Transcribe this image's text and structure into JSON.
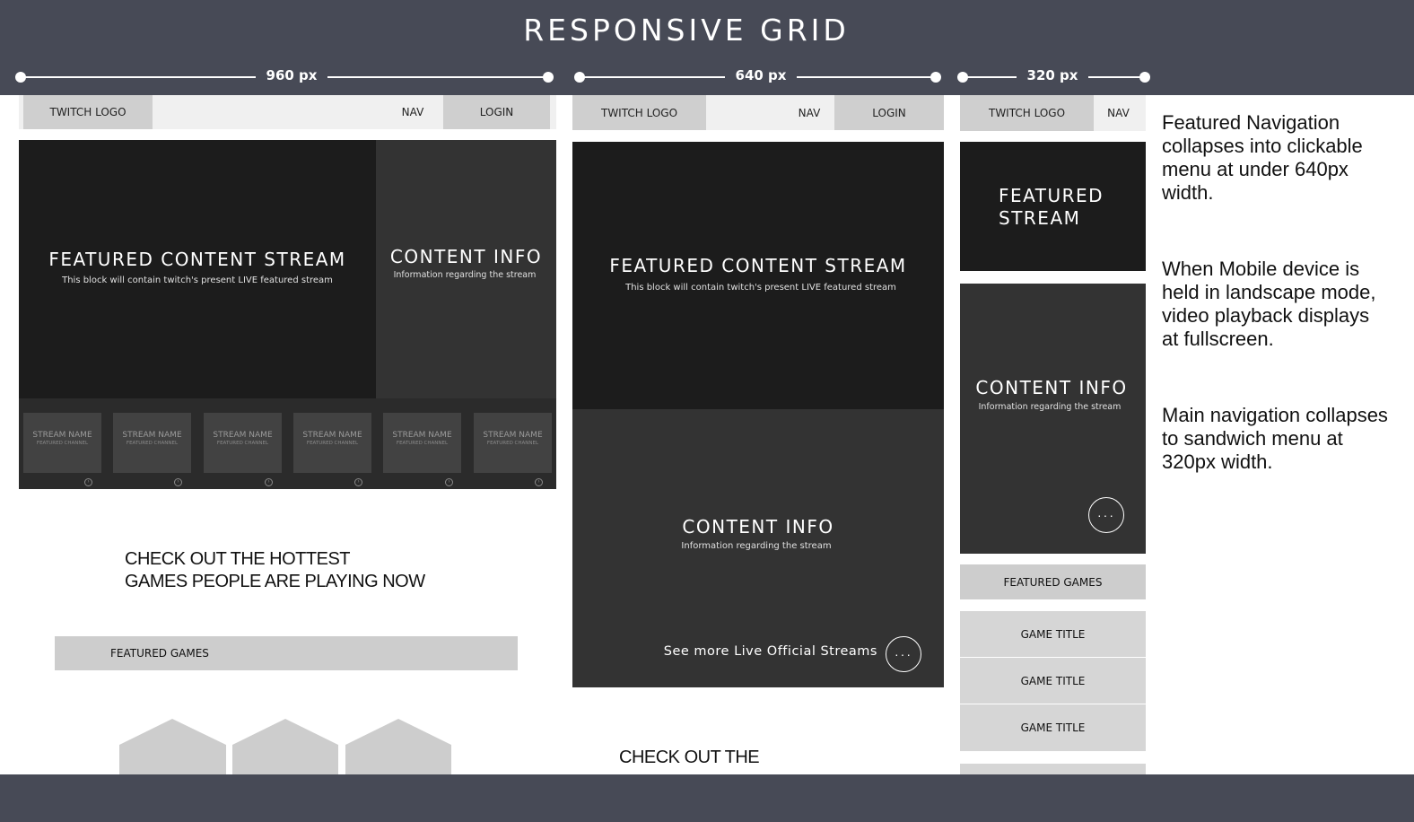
{
  "header": {
    "title": "RESPONSIVE GRID"
  },
  "rulers": {
    "r960": "960 px",
    "r640": "640 px",
    "r320": "320 px"
  },
  "layout960": {
    "logo": "TWITCH LOGO",
    "nav": "NAV",
    "login": "LOGIN",
    "featured_title": "FEATURED CONTENT STREAM",
    "featured_sub": "This block will contain twitch's present LIVE featured stream",
    "info_title": "CONTENT INFO",
    "info_sub": "Information regarding the stream",
    "thumbs": [
      {
        "name": "STREAM NAME",
        "sub": "FEATURED CHANNEL"
      },
      {
        "name": "STREAM NAME",
        "sub": "FEATURED CHANNEL"
      },
      {
        "name": "STREAM NAME",
        "sub": "FEATURED CHANNEL"
      },
      {
        "name": "STREAM NAME",
        "sub": "FEATURED CHANNEL"
      },
      {
        "name": "STREAM NAME",
        "sub": "FEATURED CHANNEL"
      },
      {
        "name": "STREAM NAME",
        "sub": "FEATURED CHANNEL"
      }
    ],
    "hot_line1": "CHECK OUT THE HOTTEST",
    "hot_line2": "GAMES PEOPLE ARE PLAYING NOW",
    "featured_games": "FEATURED GAMES"
  },
  "layout640": {
    "logo": "TWITCH LOGO",
    "nav": "NAV",
    "login": "LOGIN",
    "featured_title": "FEATURED CONTENT STREAM",
    "featured_sub": "This block will contain twitch's present LIVE featured stream",
    "info_title": "CONTENT INFO",
    "info_sub": "Information regarding the stream",
    "see_more": "See more Live Official Streams",
    "dots": "···",
    "hot_line1": "CHECK OUT THE"
  },
  "layout320": {
    "logo": "TWITCH LOGO",
    "nav": "NAV",
    "featured_line1": "FEATURED",
    "featured_line2": "STREAM",
    "info_title": "CONTENT INFO",
    "info_sub": "Information regarding the stream",
    "dots": "···",
    "featured_games": "FEATURED GAMES",
    "games": [
      "GAME TITLE",
      "GAME TITLE",
      "GAME TITLE"
    ]
  },
  "notes": [
    [
      "Featured Navigation",
      "collapses into clickable",
      "menu at under 640px",
      "width."
    ],
    [
      "When Mobile device is",
      "held in landscape mode,",
      "video playback displays",
      "at fullscreen."
    ],
    [
      "Main navigation collapses",
      "to sandwich menu at",
      "320px width."
    ]
  ]
}
